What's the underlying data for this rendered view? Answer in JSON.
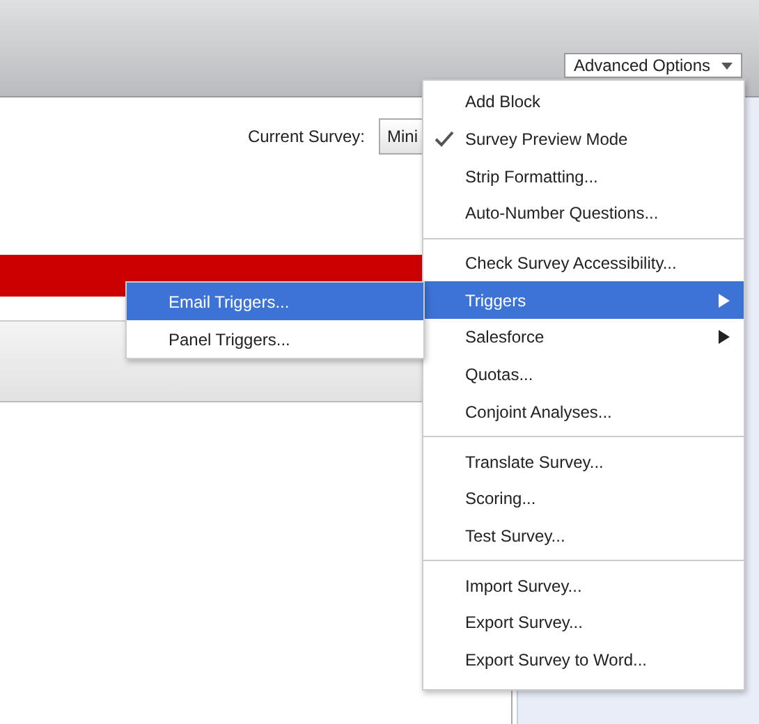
{
  "toolbar": {
    "advanced_options": "Advanced Options"
  },
  "current_survey": {
    "label": "Current Survey:",
    "value": "Mini"
  },
  "menu": {
    "sections": [
      [
        {
          "label": "Add Block",
          "checked": false,
          "selected": false,
          "has_submenu": false
        },
        {
          "label": "Survey Preview Mode",
          "checked": true,
          "selected": false,
          "has_submenu": false
        },
        {
          "label": "Strip Formatting...",
          "checked": false,
          "selected": false,
          "has_submenu": false
        },
        {
          "label": "Auto-Number Questions...",
          "checked": false,
          "selected": false,
          "has_submenu": false
        }
      ],
      [
        {
          "label": "Check Survey Accessibility...",
          "checked": false,
          "selected": false,
          "has_submenu": false
        },
        {
          "label": "Triggers",
          "checked": false,
          "selected": true,
          "has_submenu": true
        },
        {
          "label": "Salesforce",
          "checked": false,
          "selected": false,
          "has_submenu": true
        },
        {
          "label": "Quotas...",
          "checked": false,
          "selected": false,
          "has_submenu": false
        },
        {
          "label": "Conjoint Analyses...",
          "checked": false,
          "selected": false,
          "has_submenu": false
        }
      ],
      [
        {
          "label": "Translate Survey...",
          "checked": false,
          "selected": false,
          "has_submenu": false
        },
        {
          "label": "Scoring...",
          "checked": false,
          "selected": false,
          "has_submenu": false
        },
        {
          "label": "Test Survey...",
          "checked": false,
          "selected": false,
          "has_submenu": false
        }
      ],
      [
        {
          "label": "Import Survey...",
          "checked": false,
          "selected": false,
          "has_submenu": false
        },
        {
          "label": "Export Survey...",
          "checked": false,
          "selected": false,
          "has_submenu": false
        },
        {
          "label": "Export Survey to Word...",
          "checked": false,
          "selected": false,
          "has_submenu": false
        }
      ]
    ]
  },
  "submenu": {
    "items": [
      {
        "label": "Email Triggers...",
        "selected": true
      },
      {
        "label": "Panel Triggers...",
        "selected": false
      }
    ]
  }
}
